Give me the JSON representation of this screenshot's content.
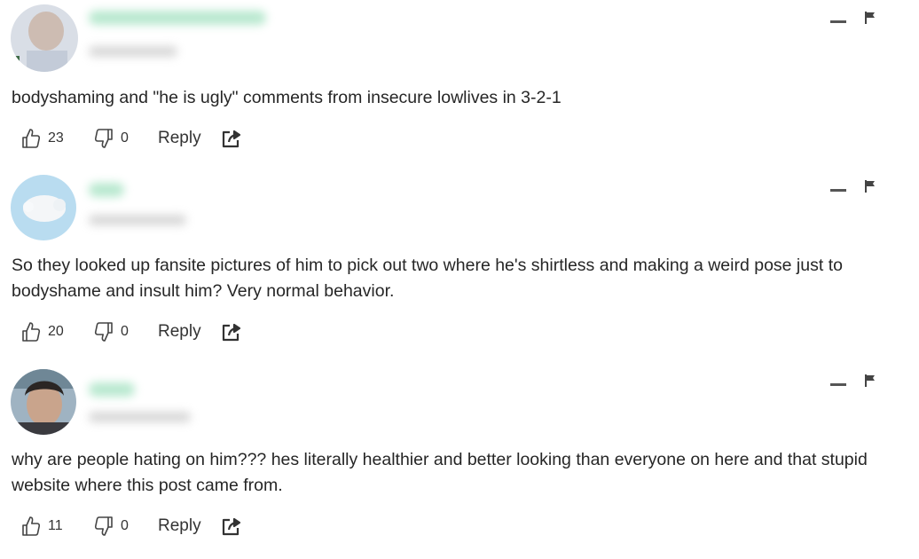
{
  "colors": {
    "text": "#262626",
    "icon": "#444444",
    "username_blur": "#7fd6a8",
    "meta_blur": "#b8b8b8"
  },
  "icons": {
    "collapse": "minus-icon",
    "report": "flag-icon",
    "like": "thumbs-up-icon",
    "dislike": "thumbs-down-icon",
    "share": "share-icon"
  },
  "comments": [
    {
      "text": "bodyshaming and \"he is ugly\" comments from insecure lowlives in 3-2-1",
      "likes": "23",
      "dislikes": "0",
      "reply_label": "Reply"
    },
    {
      "text": "So they looked up fansite pictures of him to pick out two where he's shirtless and making a weird pose just to bodyshame and insult him? Very normal behavior.",
      "likes": "20",
      "dislikes": "0",
      "reply_label": "Reply"
    },
    {
      "text": "why are people hating on him??? hes literally healthier and better looking than everyone on here and that stupid website where this post came from.",
      "likes": "11",
      "dislikes": "0",
      "reply_label": "Reply"
    }
  ]
}
